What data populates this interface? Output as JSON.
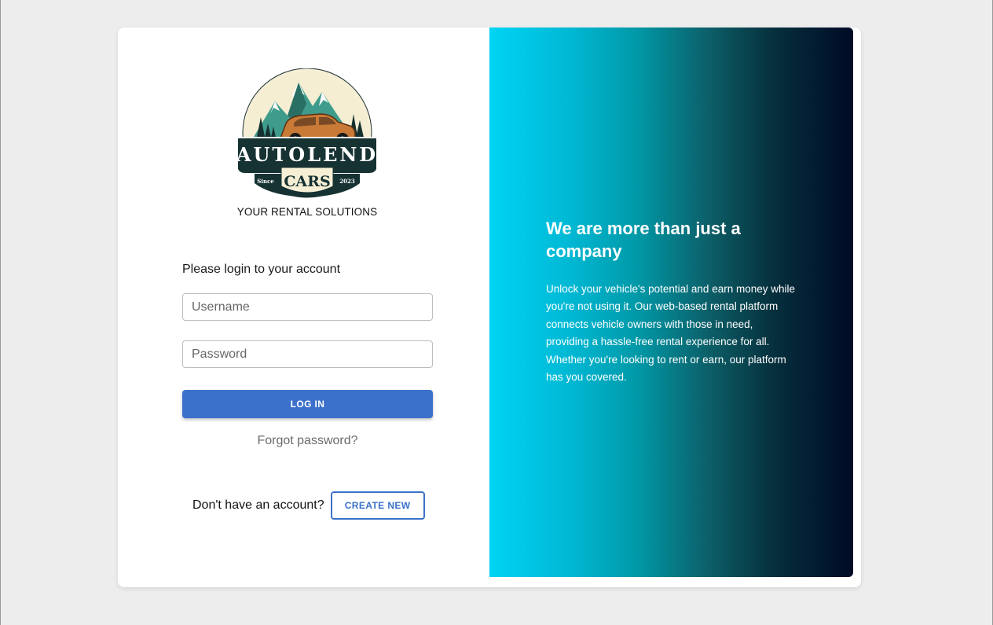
{
  "brand": {
    "logo_main": "AUTOLEND",
    "logo_sub": "CARS",
    "logo_since": "Since",
    "logo_year": "2023",
    "tagline": "YOUR RENTAL SOLUTIONS"
  },
  "login": {
    "prompt": "Please login to your account",
    "username_placeholder": "Username",
    "username_value": "",
    "password_placeholder": "Password",
    "password_value": "",
    "login_button": "LOG IN",
    "forgot_link": "Forgot password?"
  },
  "signup": {
    "text": "Don't have an account?",
    "create_button": "CREATE NEW"
  },
  "promo": {
    "title": "We are more than just a company",
    "body": "Unlock your vehicle's potential and earn money while you're not using it. Our web-based rental platform connects vehicle owners with those in need, providing a hassle-free rental experience for all. Whether you're looking to rent or earn, our platform has you covered."
  },
  "colors": {
    "primary": "#3b71ca",
    "gradient_start": "#00d4f5",
    "gradient_end": "#010a26",
    "background": "#ededed"
  }
}
